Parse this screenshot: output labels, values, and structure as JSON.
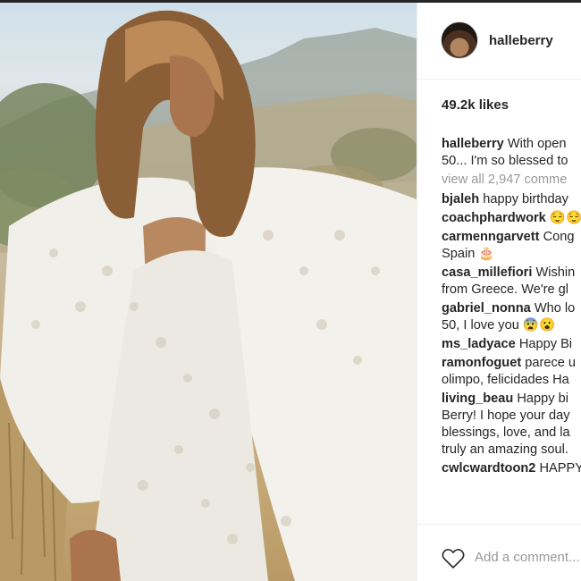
{
  "post": {
    "username": "halleberry",
    "likes": "49.2k likes",
    "caption": {
      "user": "halleberry",
      "lines": [
        "With open",
        "50... I'm so blessed to"
      ]
    },
    "view_all": "view all 2,947 comme",
    "comments": [
      {
        "user": "bjaleh",
        "lines": [
          "happy birthday"
        ]
      },
      {
        "user": "coachphardwork",
        "lines": [
          "😌😌"
        ]
      },
      {
        "user": "carmenngarvett",
        "lines": [
          "Cong",
          "Spain 🎂"
        ]
      },
      {
        "user": "casa_millefiori",
        "lines": [
          "Wishin",
          "from Greece. We're gl"
        ]
      },
      {
        "user": "gabriel_nonna",
        "lines": [
          "Who lo",
          "50, I love you 😨😮"
        ]
      },
      {
        "user": "ms_ladyace",
        "lines": [
          "Happy Bi"
        ]
      },
      {
        "user": "ramonfoguet",
        "lines": [
          "parece u",
          "olimpo, felicidades Ha"
        ]
      },
      {
        "user": "living_beau",
        "lines": [
          "Happy bi",
          "Berry! I hope your day",
          "blessings, love, and la",
          "truly an amazing soul."
        ]
      },
      {
        "user": "cwlcwardtoon2",
        "lines": [
          "HAPPY"
        ]
      }
    ],
    "add_comment_placeholder": "Add a comment...",
    "icons": {
      "like": "heart-outline-icon"
    },
    "colors": {
      "text": "#262626",
      "muted": "#999999",
      "divider": "#efefef"
    }
  }
}
